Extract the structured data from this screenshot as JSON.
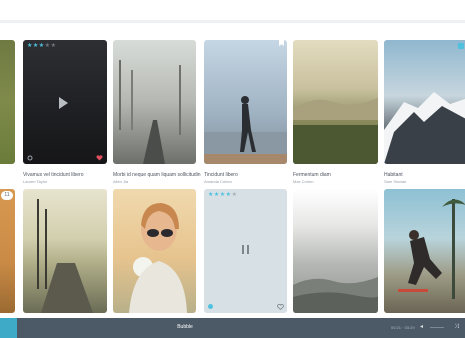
{
  "cards_row1": [
    {
      "title": "",
      "subtitle": ""
    },
    {
      "title": "Vivamus vel tincidunt libero",
      "subtitle": "Lauren Taylor",
      "rating": 3,
      "max_rating": 5
    },
    {
      "title": "Morbi id neque quam liquam sollicitudin",
      "subtitle": "Allen Jia"
    },
    {
      "title": "Tincidunt libero",
      "subtitle": "Amanda Cohen"
    },
    {
      "title": "Fermentum diam",
      "subtitle": "Max Cohen"
    },
    {
      "title": "Habitant",
      "subtitle": "Sam Sinclair"
    }
  ],
  "cards_row2": [
    {
      "badge": "11"
    },
    {},
    {},
    {
      "rating": 4,
      "max_rating": 5
    },
    {},
    {}
  ],
  "player": {
    "track_label": "Bubble",
    "time": "00:21 · 03:29"
  },
  "icons": [
    "top-right-control-icon",
    "play-icon",
    "settings-icon",
    "heart-icon",
    "bookmark-icon",
    "info-icon",
    "pause-icon",
    "volume-icon",
    "shuffle-icon"
  ],
  "colors": {
    "accent": "#3fa9c8",
    "player_bar": "#4c5a68",
    "star_on": "#4fc1df",
    "heart": "#e0505f"
  }
}
